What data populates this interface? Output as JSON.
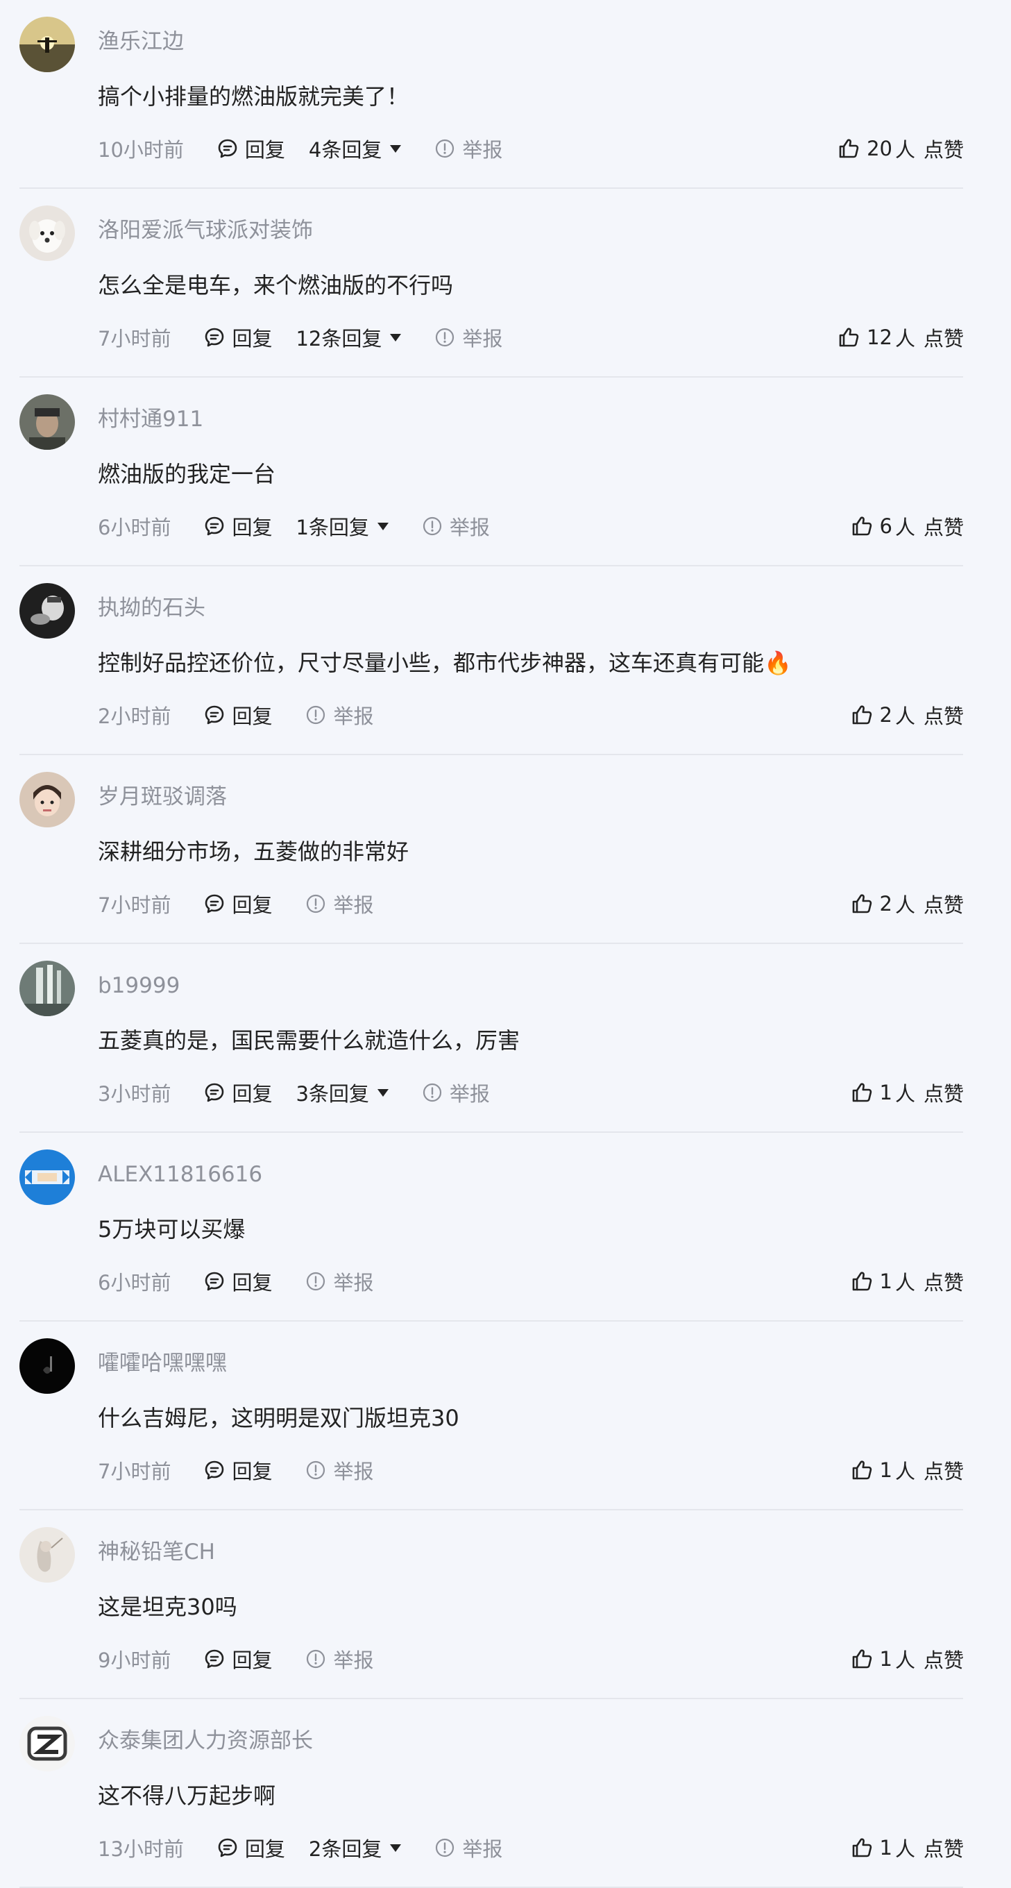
{
  "labels": {
    "reply": "回复",
    "report": "举报",
    "like_unit": "人",
    "like": "点赞"
  },
  "comments": [
    {
      "user": "渔乐江边",
      "text": "搞个小排量的燃油版就完美了！",
      "time": "10小时前",
      "replies": "4条回复",
      "likes": "20",
      "avatar": {
        "bg": "#c7b27a",
        "kind": "sunset"
      }
    },
    {
      "user": "洛阳爱派气球派对装饰",
      "text": "怎么全是电车，来个燃油版的不行吗",
      "time": "7小时前",
      "replies": "12条回复",
      "likes": "12",
      "avatar": {
        "bg": "#e9e4df",
        "kind": "dog"
      }
    },
    {
      "user": "村村通911",
      "text": "燃油版的我定一台",
      "time": "6小时前",
      "replies": "1条回复",
      "likes": "6",
      "avatar": {
        "bg": "#5b5f58",
        "kind": "person"
      }
    },
    {
      "user": "执拗的石头",
      "text": "控制好品控还价位，尺寸尽量小些，都市代步神器，这车还真有可能🔥",
      "time": "2小时前",
      "replies": "",
      "likes": "2",
      "avatar": {
        "bg": "#2f2f2f",
        "kind": "bw"
      }
    },
    {
      "user": "岁月斑驳调落",
      "text": "深耕细分市场，五菱做的非常好",
      "time": "7小时前",
      "replies": "",
      "likes": "2",
      "avatar": {
        "bg": "#d9c7b7",
        "kind": "child"
      }
    },
    {
      "user": "b19999",
      "text": "五菱真的是，国民需要什么就造什么，厉害",
      "time": "3小时前",
      "replies": "3条回复",
      "likes": "1",
      "avatar": {
        "bg": "#7d8a86",
        "kind": "waterfall"
      }
    },
    {
      "user": "ALEX11816616",
      "text": "5万块可以买爆",
      "time": "6小时前",
      "replies": "",
      "likes": "1",
      "avatar": {
        "bg": "#1e7fd8",
        "kind": "blue"
      }
    },
    {
      "user": "嚯嚯哈嘿嘿嘿",
      "text": "什么吉姆尼，这明明是双门版坦克30",
      "time": "7小时前",
      "replies": "",
      "likes": "1",
      "avatar": {
        "bg": "#050505",
        "kind": "dark"
      }
    },
    {
      "user": "神秘铅笔CH",
      "text": "这是坦克30吗",
      "time": "9小时前",
      "replies": "",
      "likes": "1",
      "avatar": {
        "bg": "#e6e2dd",
        "kind": "sketch"
      }
    },
    {
      "user": "众泰集团人力资源部长",
      "text": "这不得八万起步啊",
      "time": "13小时前",
      "replies": "2条回复",
      "likes": "1",
      "avatar": {
        "bg": "#f2f2f2",
        "kind": "logo"
      }
    }
  ]
}
